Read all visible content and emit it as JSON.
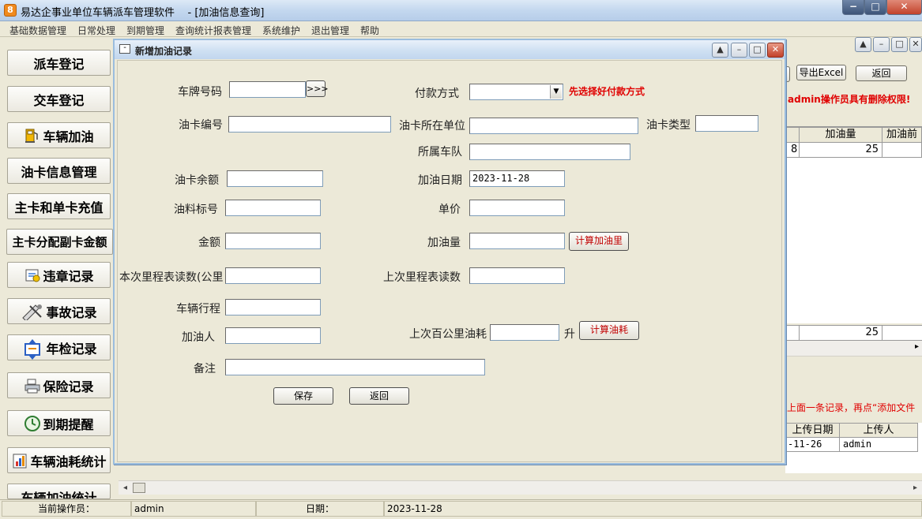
{
  "app": {
    "title": "易达企事业单位车辆派车管理软件    - [加油信息查询]",
    "icon_char": "8",
    "window_buttons": {
      "minimize": "−",
      "maximize": "□",
      "close": "✕"
    }
  },
  "menu": {
    "items": [
      "基础数据管理",
      "日常处理",
      "到期管理",
      "查询统计报表管理",
      "系统维护",
      "退出管理",
      "帮助"
    ]
  },
  "sidebar": {
    "items": [
      {
        "label": "派车登记",
        "icon": ""
      },
      {
        "label": "交车登记",
        "icon": ""
      },
      {
        "label": "车辆加油",
        "icon": "fuel-pump-icon"
      },
      {
        "label": "油卡信息管理",
        "icon": ""
      },
      {
        "label": "主卡和单卡充值",
        "icon": ""
      },
      {
        "label": "主卡分配副卡金额",
        "icon": ""
      },
      {
        "label": "违章记录",
        "icon": "violation-icon"
      },
      {
        "label": "事故记录",
        "icon": "accident-icon"
      },
      {
        "label": "年检记录",
        "icon": "inspection-icon"
      },
      {
        "label": "保险记录",
        "icon": "printer-icon"
      },
      {
        "label": "到期提醒",
        "icon": "clock-icon"
      },
      {
        "label": "车辆油耗统计",
        "icon": "stats-icon"
      },
      {
        "label": "车辆加油统计",
        "icon": ""
      }
    ]
  },
  "background": {
    "export_excel": "导出Excel",
    "back": "返回",
    "permission_note": "admin操作员具有删除权限!",
    "grid_headers": [
      "加油量",
      "加油前"
    ],
    "grid_row": [
      "8",
      "25"
    ],
    "grid_total": "25",
    "upload_hint": "上面一条记录，再点“添加文件",
    "upload_headers": [
      "上传日期",
      "上传人"
    ],
    "upload_row": [
      "-11-26",
      "admin"
    ]
  },
  "dialog": {
    "title": "新增加油记录",
    "window_buttons": {
      "up": "▲",
      "minimize": "–",
      "maximize": "□",
      "close": "✕"
    },
    "fields": {
      "plate_label": "车牌号码",
      "plate_value": "",
      "plate_lookup_button": ">>>",
      "payment_label": "付款方式",
      "payment_value": "",
      "payment_hint": "先选择好付款方式",
      "card_no_label": "油卡编号",
      "card_no_value": "",
      "card_unit_label": "油卡所在单位",
      "card_unit_value": "",
      "card_type_label": "油卡类型",
      "card_type_value": "",
      "team_label": "所属车队",
      "team_value": "",
      "balance_label": "油卡余额",
      "balance_value": "",
      "fuel_date_label": "加油日期",
      "fuel_date_value": "2023-11-28",
      "grade_label": "油料标号",
      "grade_value": "",
      "price_label": "单价",
      "price_value": "",
      "amount_label": "金额",
      "amount_value": "",
      "volume_label": "加油量",
      "volume_value": "",
      "calc_volume_button": "计算加油里",
      "odo_now_label": "本次里程表读数(公里",
      "odo_now_value": "",
      "odo_last_label": "上次里程表读数",
      "odo_last_value": "",
      "trip_label": "车辆行程",
      "trip_value": "",
      "refueler_label": "加油人",
      "refueler_value": "",
      "last_consumption_label": "上次百公里油耗",
      "last_consumption_value": "",
      "unit_liter": "升",
      "calc_consumption_button": "计算油耗",
      "remark_label": "备注",
      "remark_value": ""
    },
    "save_button": "保存",
    "back_button": "返回"
  },
  "status": {
    "operator_label": "当前操作员：",
    "operator_value": "admin",
    "date_label": "日期：",
    "date_value": "2023-11-28"
  },
  "colors": {
    "hint_red": "#e00000",
    "button_red_text": "#c00000",
    "window_face": "#ece9d8"
  }
}
